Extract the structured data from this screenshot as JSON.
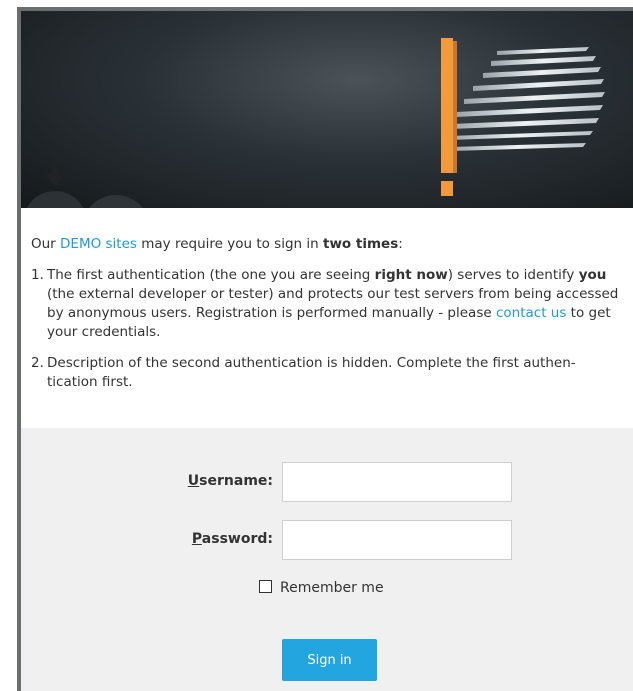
{
  "intro": {
    "before": "Our ",
    "link": "DEMO sites",
    "middle": " may require you to sign in ",
    "bold": "two times",
    "after": ":"
  },
  "list": {
    "item1": {
      "num": "1.",
      "t1": "The first authentication (the one you are seeing ",
      "b1": "right now",
      "t2": ") serves to identify ",
      "b2": "you",
      "t3": " (the external developer or tester) and protects our test servers from being accessed by anonymous users. Registration is performed manually - please ",
      "link": "contact us",
      "t4": " to get your credentials."
    },
    "item2": {
      "num": "2.",
      "text": "Description of the second authentication is hidden. Complete the first authen-tication first."
    }
  },
  "form": {
    "username_key": "U",
    "username_rest": "sername:",
    "password_key": "P",
    "password_rest": "assword:",
    "username_value": "",
    "password_value": "",
    "remember_label": "Remember me",
    "remember_checked": false,
    "signin_label": "Sign in"
  },
  "colors": {
    "link": "#1e9bd7",
    "button": "#23a5df",
    "accent_orange": "#f39a3b"
  }
}
